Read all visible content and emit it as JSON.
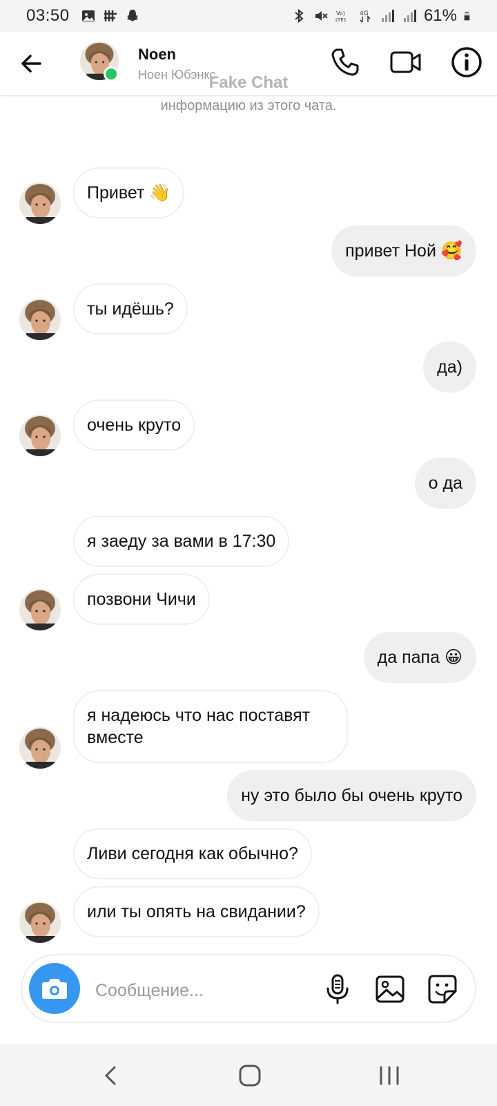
{
  "status_bar": {
    "time": "03:50",
    "battery": "61%",
    "left_icons": [
      "image-notification-icon",
      "app-notification-icon",
      "snapchat-icon"
    ],
    "right_icons": [
      "bluetooth-icon",
      "mute-icon",
      "volte-icon",
      "4g-icon",
      "signal-icon",
      "signal-icon",
      "battery-icon"
    ]
  },
  "header": {
    "contact_name": "Noen",
    "contact_subtitle": "Ноен Юбэнкс",
    "online_color": "#22c55e"
  },
  "watermark": "Fake Chat",
  "system_note": "информацию из этого чата.",
  "messages": [
    {
      "dir": "in",
      "text": "Привет 👋",
      "avatar": true
    },
    {
      "dir": "out",
      "text": "привет Ной 🥰"
    },
    {
      "dir": "in",
      "text": "ты идёшь?",
      "avatar": true
    },
    {
      "dir": "out",
      "text": "да)"
    },
    {
      "dir": "in",
      "text": "очень круто",
      "avatar": true
    },
    {
      "dir": "out",
      "text": "о да"
    },
    {
      "dir": "in",
      "text": "я заеду за вами в 17:30",
      "avatar": false
    },
    {
      "dir": "in",
      "text": "позвони Чичи",
      "avatar": true
    },
    {
      "dir": "out",
      "text": "да папа 😀"
    },
    {
      "dir": "in",
      "text": "я надеюсь что нас поставят вместе",
      "avatar": true
    },
    {
      "dir": "out",
      "text": "ну это было бы очень круто"
    },
    {
      "dir": "in",
      "text": "Ливи сегодня как обычно?",
      "avatar": false
    },
    {
      "dir": "in",
      "text": "или ты опять на свидании?",
      "avatar": true
    }
  ],
  "composer": {
    "placeholder": "Сообщение...",
    "camera_color": "#3797f0"
  },
  "navbar": {
    "buttons": [
      "back-icon",
      "home-icon",
      "recents-icon"
    ]
  }
}
